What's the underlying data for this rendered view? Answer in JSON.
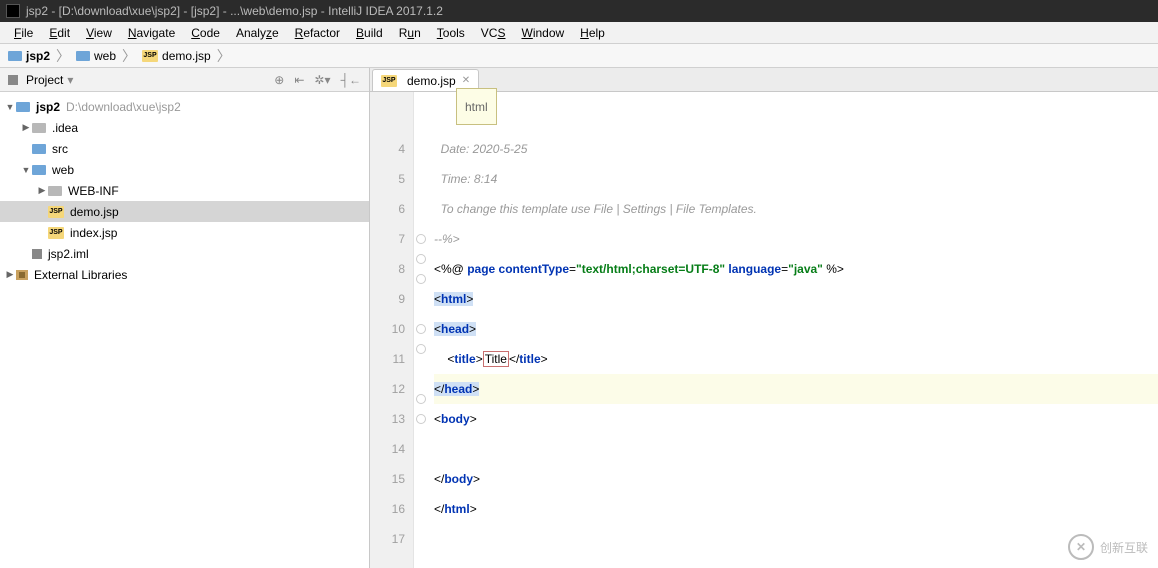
{
  "window": {
    "title": "jsp2 - [D:\\download\\xue\\jsp2] - [jsp2] - ...\\web\\demo.jsp - IntelliJ IDEA 2017.1.2"
  },
  "menu": {
    "file": "File",
    "edit": "Edit",
    "view": "View",
    "navigate": "Navigate",
    "code": "Code",
    "analyze": "Analyze",
    "refactor": "Refactor",
    "build": "Build",
    "run": "Run",
    "tools": "Tools",
    "vcs": "VCS",
    "window": "Window",
    "help": "Help"
  },
  "nav": {
    "c0": "jsp2",
    "c1": "web",
    "c2": "demo.jsp"
  },
  "sidebar": {
    "title": "Project",
    "tree": {
      "root": "jsp2",
      "root_path": "D:\\download\\xue\\jsp2",
      "idea": ".idea",
      "src": "src",
      "web": "web",
      "webinf": "WEB-INF",
      "demo": "demo.jsp",
      "index": "index.jsp",
      "iml": "jsp2.iml",
      "ext": "External Libraries"
    }
  },
  "tab": {
    "name": "demo.jsp"
  },
  "crumb": {
    "text": "html"
  },
  "code": {
    "l4": "  Date: 2020-5-25",
    "l5": "  Time: 8:14",
    "l6": "  To change this template use File | Settings | File Templates.",
    "l7": "--%>",
    "l8_pre": "<%@ ",
    "l8_page": "page ",
    "l8_ct": "contentType",
    "l8_eq": "=",
    "l8_ctv": "\"text/html;charset=UTF-8\"",
    "l8_lang": " language",
    "l8_langv": "\"java\"",
    "l8_end": " %>",
    "html_open": "html",
    "html_close": "html",
    "head_open": "head",
    "head_close": "head",
    "body_open": "body",
    "body_close": "body",
    "title_open": "title",
    "title_text": "Title",
    "title_close": "title"
  },
  "gutter": {
    "l4": "4",
    "l5": "5",
    "l6": "6",
    "l7": "7",
    "l8": "8",
    "l9": "9",
    "l10": "10",
    "l11": "11",
    "l12": "12",
    "l13": "13",
    "l14": "14",
    "l15": "15",
    "l16": "16",
    "l17": "17"
  },
  "watermark": {
    "text": "创新互联"
  }
}
